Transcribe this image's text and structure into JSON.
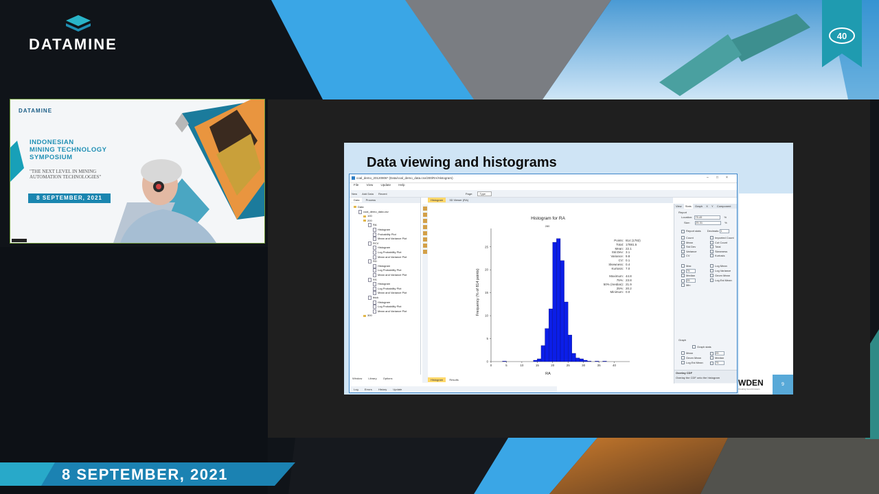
{
  "brand": {
    "logo_text": "DATAMINE",
    "anniversary_badge": "40",
    "banner_date": "8 SEPTEMBER, 2021"
  },
  "webcam": {
    "logo_text": "DATAMINE",
    "event_title_lines": [
      "INDONESIAN",
      "MINING TECHNOLOGY",
      "SYMPOSIUM"
    ],
    "tagline_lines": [
      "\"THE NEXT LEVEL IN MINING",
      "AUTOMATION TECHNOLOGIES\""
    ],
    "date": "8 SEPTEMBER, 2021"
  },
  "slide": {
    "title": "Data viewing and histograms",
    "brand_fragment": "WDEN",
    "brand_sub": "Creating Good Answers",
    "page_number": "9"
  },
  "app": {
    "window_title": "coal_demo_20120906* (Data/coal_demo_data.csv/200/RA/Histogram)",
    "window_controls": [
      "–",
      "□",
      "×"
    ],
    "menu": [
      "File",
      "View",
      "Update",
      "Help"
    ],
    "toolbar": {
      "new": "New",
      "add_data": "Add Data",
      "recent": "Recent",
      "page_label": "Page:",
      "type_value": "Type"
    },
    "tree_tabs": [
      "Data",
      "Process"
    ],
    "tree": [
      {
        "label": "Data",
        "depth": 0,
        "kind": "folder"
      },
      {
        "label": "coal_demo_data.csv",
        "depth": 1,
        "kind": "file"
      },
      {
        "label": "100",
        "depth": 2,
        "kind": "folder"
      },
      {
        "label": "200",
        "depth": 2,
        "kind": "folder"
      },
      {
        "label": "RA",
        "depth": 3,
        "kind": "file"
      },
      {
        "label": "Histogram",
        "depth": 4,
        "kind": "file"
      },
      {
        "label": "Probability Plot",
        "depth": 4,
        "kind": "file"
      },
      {
        "label": "Mean and Variance Plot",
        "depth": 4,
        "kind": "file"
      },
      {
        "label": "RCV",
        "depth": 3,
        "kind": "file"
      },
      {
        "label": "Histogram",
        "depth": 4,
        "kind": "file"
      },
      {
        "label": "Log Probability Plot",
        "depth": 4,
        "kind": "file"
      },
      {
        "label": "Mean and Variance Plot",
        "depth": 4,
        "kind": "file"
      },
      {
        "label": "RD",
        "depth": 3,
        "kind": "file"
      },
      {
        "label": "Histogram",
        "depth": 4,
        "kind": "file"
      },
      {
        "label": "Log Probability Plot",
        "depth": 4,
        "kind": "file"
      },
      {
        "label": "Mean and Variance Plot",
        "depth": 4,
        "kind": "file"
      },
      {
        "label": "RS",
        "depth": 3,
        "kind": "file"
      },
      {
        "label": "Histogram",
        "depth": 4,
        "kind": "file"
      },
      {
        "label": "Log Probability Plot",
        "depth": 4,
        "kind": "file"
      },
      {
        "label": "Mean and Variance Plot",
        "depth": 4,
        "kind": "file"
      },
      {
        "label": "thick",
        "depth": 3,
        "kind": "file"
      },
      {
        "label": "Histogram",
        "depth": 4,
        "kind": "file"
      },
      {
        "label": "Log Probability Plot",
        "depth": 4,
        "kind": "file"
      },
      {
        "label": "Mean and Variance Plot",
        "depth": 4,
        "kind": "file"
      },
      {
        "label": "300",
        "depth": 2,
        "kind": "folder"
      }
    ],
    "tree_bottom_tabs": [
      "Window",
      "Library",
      "Options"
    ],
    "status_tabs": [
      "Log",
      "Errors",
      "History",
      "Update"
    ],
    "view_tabs": [
      "Histogram",
      "3D Viewer (RA)"
    ],
    "result_tabs": [
      "Histogram",
      "Results"
    ],
    "stats": [
      {
        "k": "Points",
        "v": "814 (1782)"
      },
      {
        "k": "Total",
        "v": "17881.5"
      },
      {
        "k": "Mean",
        "v": "22.1"
      },
      {
        "k": "Std.Dev",
        "v": "3.1"
      },
      {
        "k": "Variance",
        "v": "9.8"
      },
      {
        "k": "CV",
        "v": "0.1"
      },
      {
        "k": "Skewness",
        "v": "0.4"
      },
      {
        "k": "Kurtosis",
        "v": "7.0"
      },
      {
        "k": "",
        "v": ""
      },
      {
        "k": "Maximum",
        "v": "44.8"
      },
      {
        "k": "75%",
        "v": "23.8"
      },
      {
        "k": "50% (median)",
        "v": "21.9"
      },
      {
        "k": "25%",
        "v": "20.2"
      },
      {
        "k": "Minimum",
        "v": "0.0"
      }
    ],
    "options": {
      "tabs": [
        "View",
        "Stats",
        "Graph",
        "X",
        "Y",
        "Component"
      ],
      "report_label": "Report",
      "location_label": "Location:",
      "location_value": "75.49",
      "size_label": "Size:",
      "size_value": "25.31",
      "pct": "%",
      "report_stats": "Report stats",
      "decimals_label": "Decimals:",
      "decimals_value": "1",
      "left_checks": [
        "Count",
        "Mean",
        "Std Dev",
        "Variance",
        "CV"
      ],
      "right_checks": [
        "Imported Count",
        "Cut Count",
        "Total",
        "Skewness",
        "Kurtosis"
      ],
      "left_checks2": [
        "Max",
        "75",
        "Median",
        "25",
        "Min"
      ],
      "right_checks2": [
        "Log Mean",
        "Log Variance",
        "Geom Mean",
        "Log Est Mean"
      ],
      "graph_label": "Graph",
      "graph_stats": "Graph stats",
      "graph_left": [
        "Mean",
        "Geom Mean",
        "Log Est Mean"
      ],
      "graph_right": [
        "25",
        "Median",
        "75"
      ],
      "hint_title": "Overlay CDF",
      "hint_text": "Overlay the CDF onto the histogram"
    }
  },
  "chart_data": {
    "type": "bar",
    "title": "Histogram for RA",
    "xlabel": "RA",
    "ylabel": "Frequency (% of 814 points)",
    "xlim": [
      0,
      45
    ],
    "ylim": [
      0,
      29
    ],
    "xticks": [
      0,
      5,
      10,
      15,
      20,
      25,
      30,
      35,
      40
    ],
    "yticks": [
      0,
      5,
      10,
      15,
      20,
      25
    ],
    "bin_width": 1.25,
    "bins": [
      {
        "x0": 3.75,
        "value": 0.1
      },
      {
        "x0": 13.75,
        "value": 0.3
      },
      {
        "x0": 15.0,
        "value": 0.6
      },
      {
        "x0": 16.25,
        "value": 3.5
      },
      {
        "x0": 17.5,
        "value": 7.2
      },
      {
        "x0": 18.75,
        "value": 11.5
      },
      {
        "x0": 20.0,
        "value": 26.0
      },
      {
        "x0": 21.25,
        "value": 26.8
      },
      {
        "x0": 22.5,
        "value": 22.0
      },
      {
        "x0": 23.75,
        "value": 13.0
      },
      {
        "x0": 25.0,
        "value": 5.8
      },
      {
        "x0": 26.25,
        "value": 1.8
      },
      {
        "x0": 27.5,
        "value": 0.8
      },
      {
        "x0": 28.75,
        "value": 0.6
      },
      {
        "x0": 30.0,
        "value": 0.3
      },
      {
        "x0": 31.25,
        "value": 0.1
      },
      {
        "x0": 33.75,
        "value": 0.1
      },
      {
        "x0": 36.25,
        "value": 0.1
      }
    ],
    "top_label": "280",
    "grid": false,
    "color": "#0b1ee8"
  }
}
